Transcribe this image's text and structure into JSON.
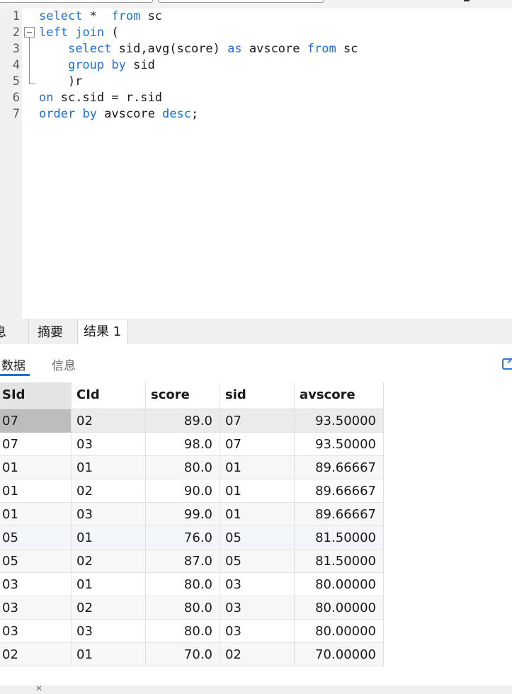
{
  "editor": {
    "lines": [
      {
        "num": "1",
        "tokens": [
          {
            "t": "select",
            "kw": true
          },
          {
            "t": " *  ",
            "kw": false
          },
          {
            "t": "from",
            "kw": true
          },
          {
            "t": " sc",
            "kw": false
          }
        ]
      },
      {
        "num": "2",
        "tokens": [
          {
            "t": "left",
            "kw": true
          },
          {
            "t": " ",
            "kw": false
          },
          {
            "t": "join",
            "kw": true
          },
          {
            "t": " (",
            "kw": false
          }
        ]
      },
      {
        "num": "3",
        "tokens": [
          {
            "t": "    ",
            "kw": false
          },
          {
            "t": "select",
            "kw": true
          },
          {
            "t": " sid,avg(score) ",
            "kw": false
          },
          {
            "t": "as",
            "kw": true
          },
          {
            "t": " avscore ",
            "kw": false
          },
          {
            "t": "from",
            "kw": true
          },
          {
            "t": " sc",
            "kw": false
          }
        ]
      },
      {
        "num": "4",
        "tokens": [
          {
            "t": "    ",
            "kw": false
          },
          {
            "t": "group",
            "kw": true
          },
          {
            "t": " ",
            "kw": false
          },
          {
            "t": "by",
            "kw": true
          },
          {
            "t": " sid",
            "kw": false
          }
        ]
      },
      {
        "num": "5",
        "tokens": [
          {
            "t": "    )r",
            "kw": false
          }
        ]
      },
      {
        "num": "6",
        "tokens": [
          {
            "t": "on",
            "kw": true
          },
          {
            "t": " sc.sid = r.sid",
            "kw": false
          }
        ]
      },
      {
        "num": "7",
        "tokens": [
          {
            "t": "order",
            "kw": true
          },
          {
            "t": " ",
            "kw": false
          },
          {
            "t": "by",
            "kw": true
          },
          {
            "t": " avscore ",
            "kw": false
          },
          {
            "t": "desc",
            "kw": true
          },
          {
            "t": ";",
            "kw": false
          }
        ]
      }
    ]
  },
  "result_tabs": {
    "messages": "息",
    "summary": "摘要",
    "result1": "结果 1"
  },
  "sub_tabs": {
    "data": "数据",
    "info": "信息"
  },
  "grid": {
    "columns": [
      "SId",
      "CId",
      "score",
      "sid",
      "avscore"
    ],
    "rows": [
      [
        "07",
        "02",
        "89.0",
        "07",
        "93.50000"
      ],
      [
        "07",
        "03",
        "98.0",
        "07",
        "93.50000"
      ],
      [
        "01",
        "01",
        "80.0",
        "01",
        "89.66667"
      ],
      [
        "01",
        "02",
        "90.0",
        "01",
        "89.66667"
      ],
      [
        "01",
        "03",
        "99.0",
        "01",
        "89.66667"
      ],
      [
        "05",
        "01",
        "76.0",
        "05",
        "81.50000"
      ],
      [
        "05",
        "02",
        "87.0",
        "05",
        "81.50000"
      ],
      [
        "03",
        "01",
        "80.0",
        "03",
        "80.00000"
      ],
      [
        "03",
        "02",
        "80.0",
        "03",
        "80.00000"
      ],
      [
        "03",
        "03",
        "80.0",
        "03",
        "80.00000"
      ],
      [
        "02",
        "01",
        "70.0",
        "02",
        "70.00000"
      ]
    ]
  },
  "colors": {
    "keyword": "#1e6fd6",
    "selected_cell": "#bdbdbd",
    "accent": "#1e6fd6"
  },
  "icons": {
    "edit": "edit-icon",
    "fold": "fold-collapse-icon"
  }
}
